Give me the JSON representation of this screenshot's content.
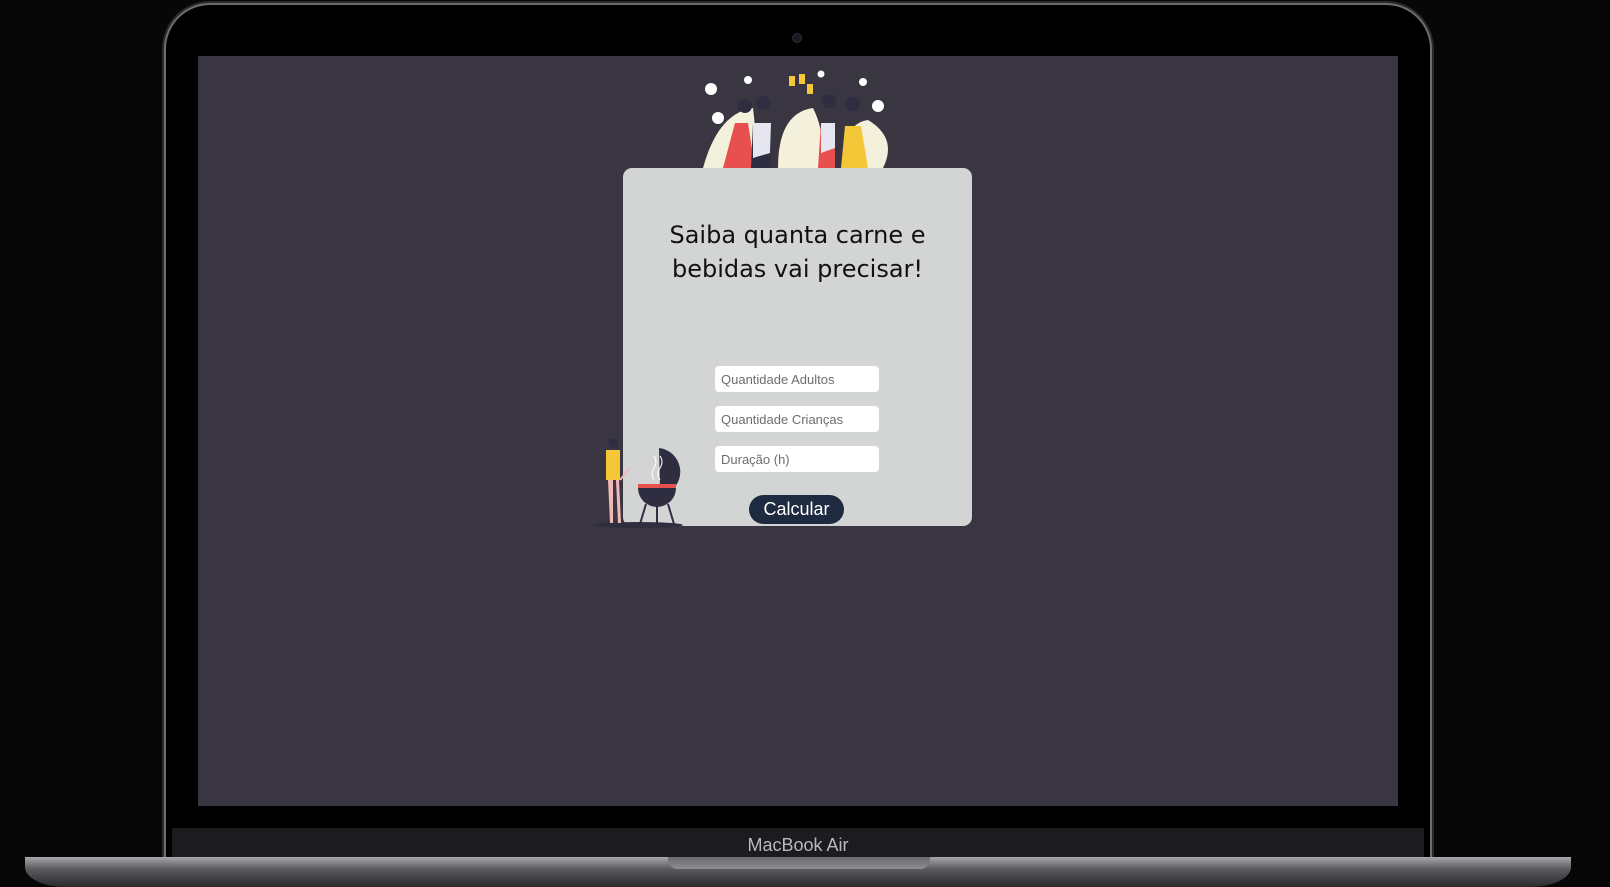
{
  "device": {
    "brand_label": "MacBook Air"
  },
  "form": {
    "title_line1": "Saiba quanta carne e",
    "title_line2": "bebidas vai precisar!",
    "adults_placeholder": "Quantidade Adultos",
    "children_placeholder": "Quantidade Crianças",
    "duration_placeholder": "Duração (h)",
    "submit_label": "Calcular"
  },
  "colors": {
    "page_background": "#393541",
    "card_background": "#d3d4d4",
    "button_background": "#1d2a3f"
  },
  "illustrations": [
    "party-toast-illustration",
    "barbecue-grill-illustration"
  ]
}
